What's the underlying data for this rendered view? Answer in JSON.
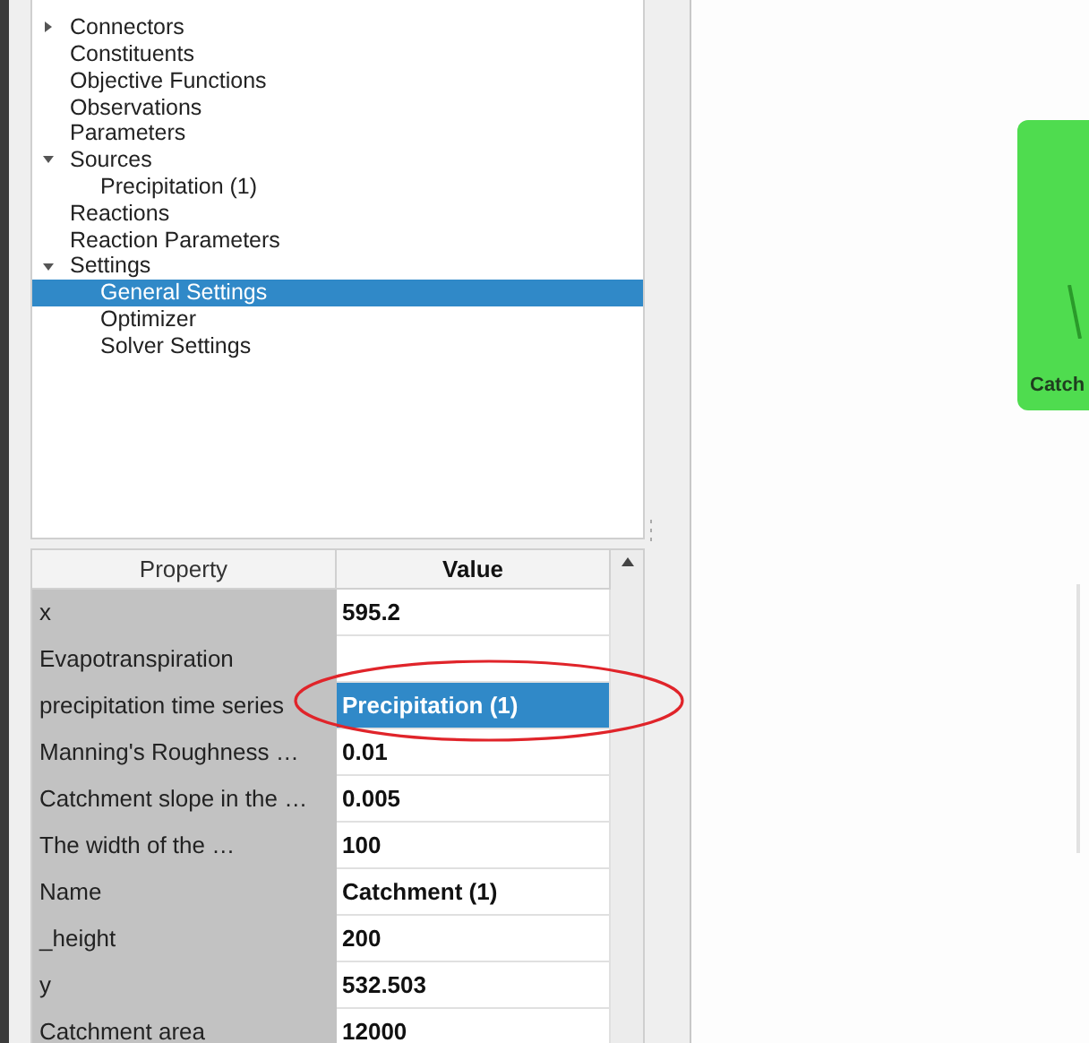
{
  "tree": [
    {
      "label": "Connectors",
      "expanded": false,
      "selected": false
    },
    {
      "label": "Constituents",
      "selected": false
    },
    {
      "label": "Objective Functions",
      "selected": false
    },
    {
      "label": "Observations",
      "selected": false
    },
    {
      "label": "Parameters",
      "selected": false
    },
    {
      "label": "Sources",
      "expanded": true,
      "selected": false,
      "children": [
        {
          "label": "Precipitation (1)",
          "selected": false
        }
      ]
    },
    {
      "label": "Reactions",
      "selected": false
    },
    {
      "label": "Reaction Parameters",
      "selected": false
    },
    {
      "label": "Settings",
      "expanded": true,
      "selected": false,
      "children": [
        {
          "label": "General Settings",
          "selected": true
        },
        {
          "label": "Optimizer",
          "selected": false
        },
        {
          "label": "Solver Settings",
          "selected": false
        }
      ]
    }
  ],
  "properties": {
    "columns": [
      "Property",
      "Value"
    ],
    "rows": [
      {
        "property": "x",
        "value": "595.2",
        "selected": false
      },
      {
        "property": "Evapotranspiration",
        "selected": false
      },
      {
        "property": "precipitation time series",
        "value": "Precipitation (1)",
        "selected": true
      },
      {
        "property": "Manning's Roughness …",
        "value": "0.01",
        "selected": false
      },
      {
        "property": "Catchment slope in the …",
        "value": "0.005",
        "selected": false
      },
      {
        "property": "The width of the …",
        "value": "100",
        "selected": false
      },
      {
        "property": "Name",
        "value": "Catchment (1)",
        "selected": false
      },
      {
        "property": "_height",
        "value": "200",
        "selected": false
      },
      {
        "property": "y",
        "value": "532.503",
        "selected": false
      },
      {
        "property": "Catchment area",
        "value": "12000",
        "selected": false
      }
    ]
  },
  "canvas": {
    "nodes": [
      {
        "label": "Catch"
      }
    ]
  }
}
